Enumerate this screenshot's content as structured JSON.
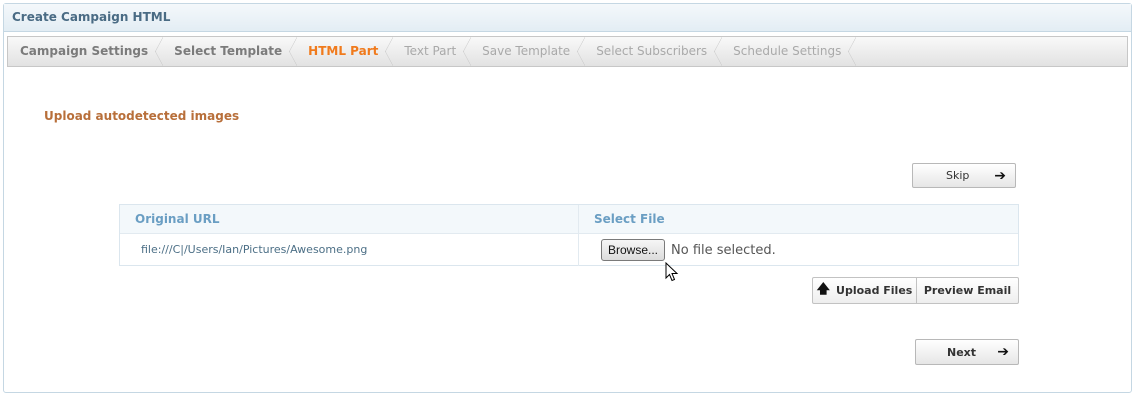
{
  "panel": {
    "title": "Create Campaign HTML"
  },
  "wizard": {
    "steps": [
      {
        "label": "Campaign Settings",
        "state": "done"
      },
      {
        "label": "Select Template",
        "state": "done"
      },
      {
        "label": "HTML Part",
        "state": "active"
      },
      {
        "label": "Text Part",
        "state": "todo"
      },
      {
        "label": "Save Template",
        "state": "todo"
      },
      {
        "label": "Select Subscribers",
        "state": "todo"
      },
      {
        "label": "Schedule Settings",
        "state": "todo"
      }
    ]
  },
  "section": {
    "title": "Upload autodetected images"
  },
  "skip_button": {
    "label": "Skip",
    "icon": "arrow-right-icon"
  },
  "table": {
    "headers": [
      "Original URL",
      "Select File"
    ],
    "rows": [
      {
        "original_url": "file:///C|/Users/Ian/Pictures/Awesome.png",
        "browse_label": "Browse...",
        "file_status": "No file selected."
      }
    ]
  },
  "actions": {
    "upload_label": "Upload Files",
    "upload_icon": "arrow-up-icon",
    "preview_label": "Preview Email"
  },
  "next_button": {
    "label": "Next",
    "icon": "arrow-right-icon"
  },
  "colors": {
    "accent": "#f07a1c",
    "header_text": "#4a6b84",
    "section_title": "#b86f3a",
    "table_header": "#6a9ec3"
  }
}
